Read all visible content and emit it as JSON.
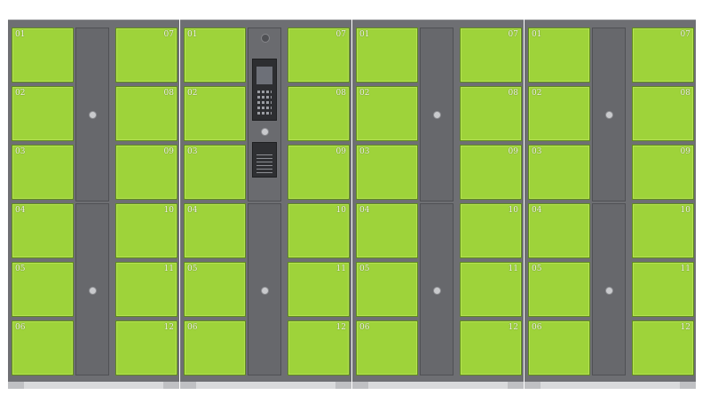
{
  "colors": {
    "door": "#9ed33a",
    "cabinet": "#6e6f73",
    "column_door": "#67686c"
  },
  "units": [
    {
      "type": "standard",
      "doors": [
        "01",
        "02",
        "03",
        "04",
        "05",
        "06",
        "07",
        "08",
        "09",
        "10",
        "11",
        "12"
      ]
    },
    {
      "type": "master",
      "doors": [
        "01",
        "02",
        "03",
        "04",
        "05",
        "06",
        "07",
        "08",
        "09",
        "10",
        "11",
        "12"
      ]
    },
    {
      "type": "standard",
      "doors": [
        "01",
        "02",
        "03",
        "04",
        "05",
        "06",
        "07",
        "08",
        "09",
        "10",
        "11",
        "12"
      ]
    },
    {
      "type": "standard",
      "doors": [
        "01",
        "02",
        "03",
        "04",
        "05",
        "06",
        "07",
        "08",
        "09",
        "10",
        "11",
        "12"
      ]
    }
  ],
  "icons": {
    "camera": "camera-icon",
    "screen": "touchscreen-icon",
    "keypad": "keypad-icon",
    "printer": "receipt-slot-icon",
    "handle": "lock-knob-icon"
  }
}
